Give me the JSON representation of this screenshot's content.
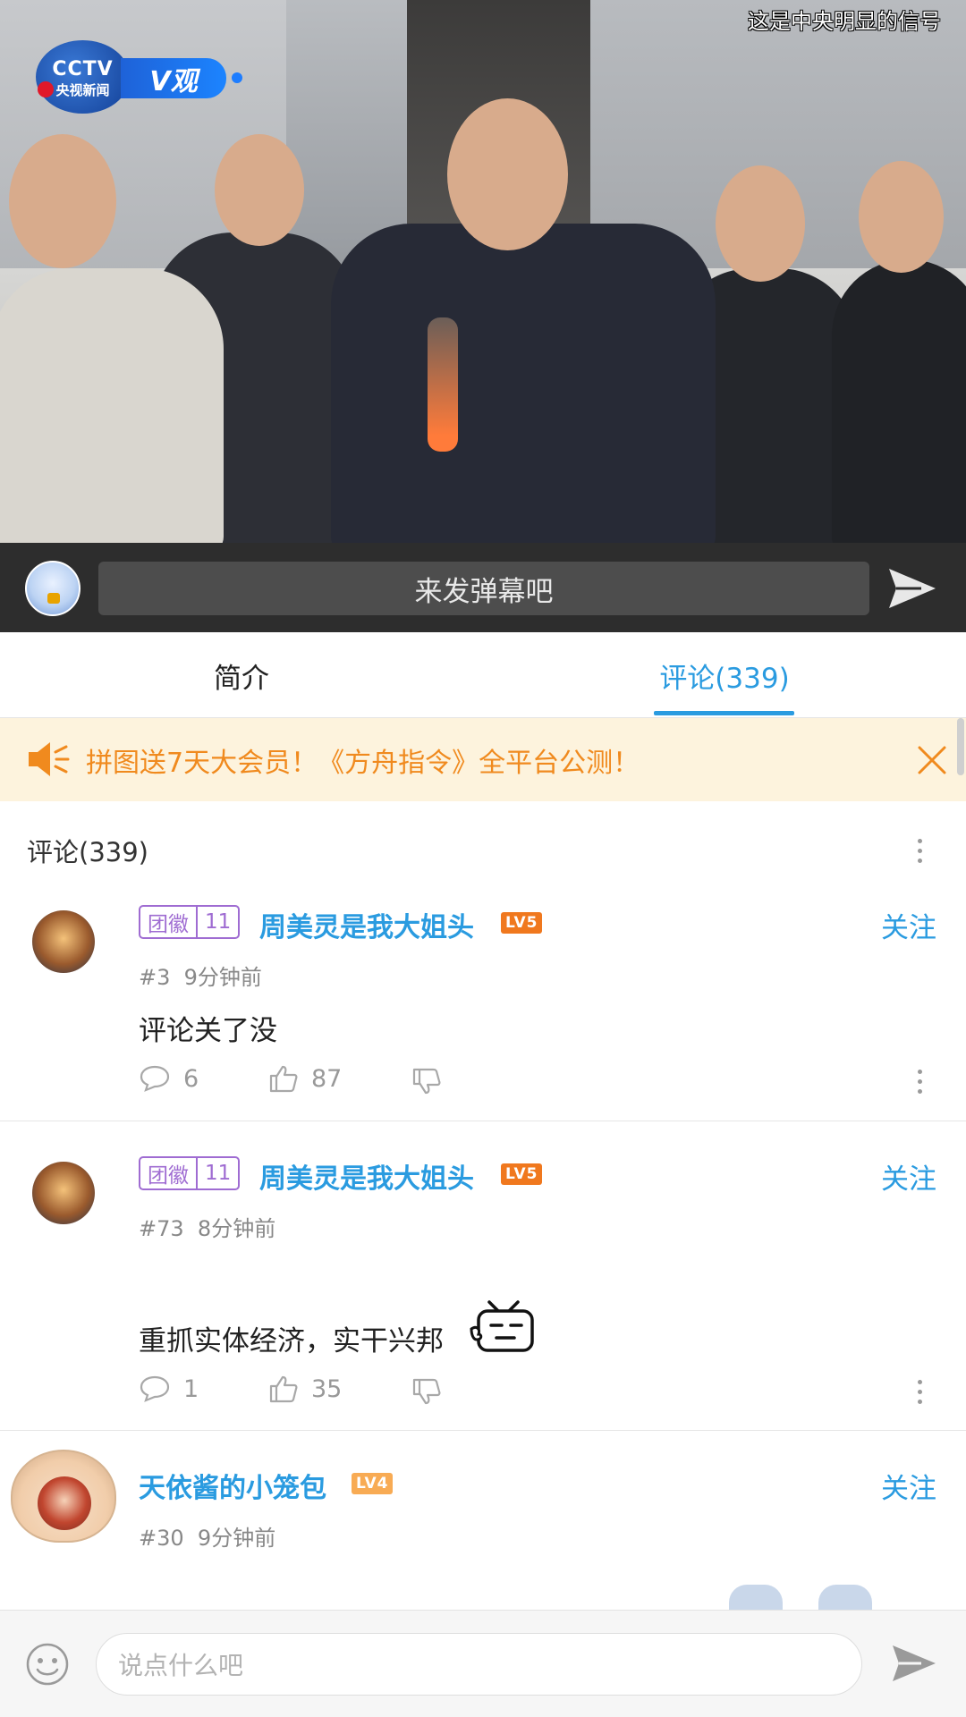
{
  "video": {
    "caption": "这是中央明显的信号",
    "channel_logo": "CCTV",
    "channel_name": "央视新闻",
    "program_tag": "V观"
  },
  "danmaku": {
    "placeholder": "来发弹幕吧"
  },
  "tabs": [
    {
      "label": "简介",
      "active": false
    },
    {
      "label": "评论(339)",
      "active": true
    }
  ],
  "notice": {
    "text": "拼图送7天大会员！《方舟指令》全平台公测！"
  },
  "comments_section": {
    "title": "评论(339)",
    "comments": [
      {
        "badge_name": "团徽",
        "badge_level": "11",
        "username": "周美灵是我大姐头",
        "level": "LV5",
        "follow_label": "关注",
        "floor": "#3",
        "time": "9分钟前",
        "text": "评论关了没",
        "replies": "6",
        "likes": "87"
      },
      {
        "badge_name": "团徽",
        "badge_level": "11",
        "username": "周美灵是我大姐头",
        "level": "LV5",
        "follow_label": "关注",
        "floor": "#73",
        "time": "8分钟前",
        "text": "重抓实体经济，实干兴邦",
        "replies": "1",
        "likes": "35"
      },
      {
        "username": "天依酱的小笼包",
        "level": "LV4",
        "follow_label": "关注",
        "floor": "#30",
        "time": "9分钟前"
      }
    ]
  },
  "bottom_input": {
    "placeholder": "说点什么吧"
  },
  "colors": {
    "accent": "#2a9be0",
    "notice_bg": "#fdf3dd",
    "notice_text": "#f08a1e",
    "badge_purple": "#9f6cd2",
    "lv5": "#f0781e",
    "lv4": "#f8ab54"
  },
  "icons": {
    "send": "send-icon",
    "speaker": "speaker-icon",
    "close": "close-icon",
    "more": "more-vertical-icon",
    "reply": "comment-bubble-icon",
    "like": "thumbs-up-icon",
    "dislike": "thumbs-down-icon",
    "emoji": "emoji-icon"
  }
}
